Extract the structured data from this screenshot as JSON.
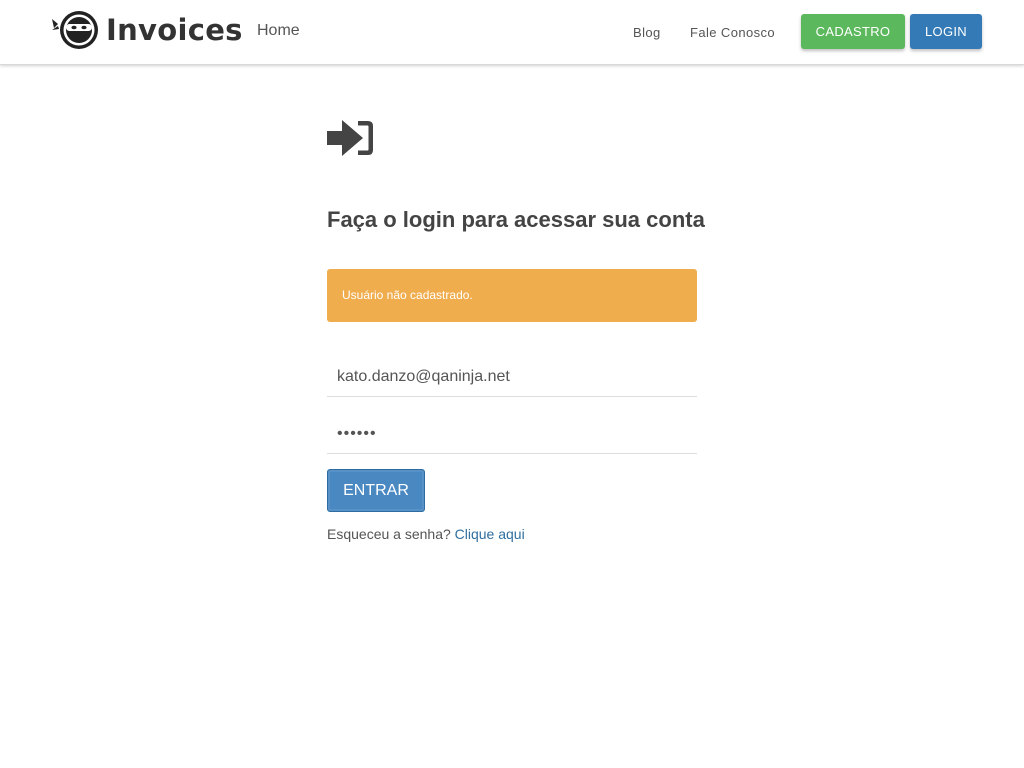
{
  "navbar": {
    "brand_text": "Invoices",
    "home_label": "Home",
    "blog_label": "Blog",
    "contact_label": "Fale Conosco",
    "signup_label": "CADASTRO",
    "login_label": "LOGIN"
  },
  "login": {
    "title": "Faça o login para acessar sua conta",
    "alert_text": "Usuário não cadastrado.",
    "email_value": "kato.danzo@qaninja.net",
    "password_value": "123456",
    "submit_label": "ENTRAR",
    "forgot_text": "Esqueceu a senha?",
    "forgot_link": "Clique aqui"
  },
  "colors": {
    "signup_button": "#5cb85c",
    "login_button": "#337ab7",
    "alert_warning": "#f0ad4e",
    "submit_button": "#4a88c2",
    "link": "#2f6f9f"
  },
  "icons": {
    "brand": "ninja-logo-icon",
    "login": "sign-in-icon"
  }
}
